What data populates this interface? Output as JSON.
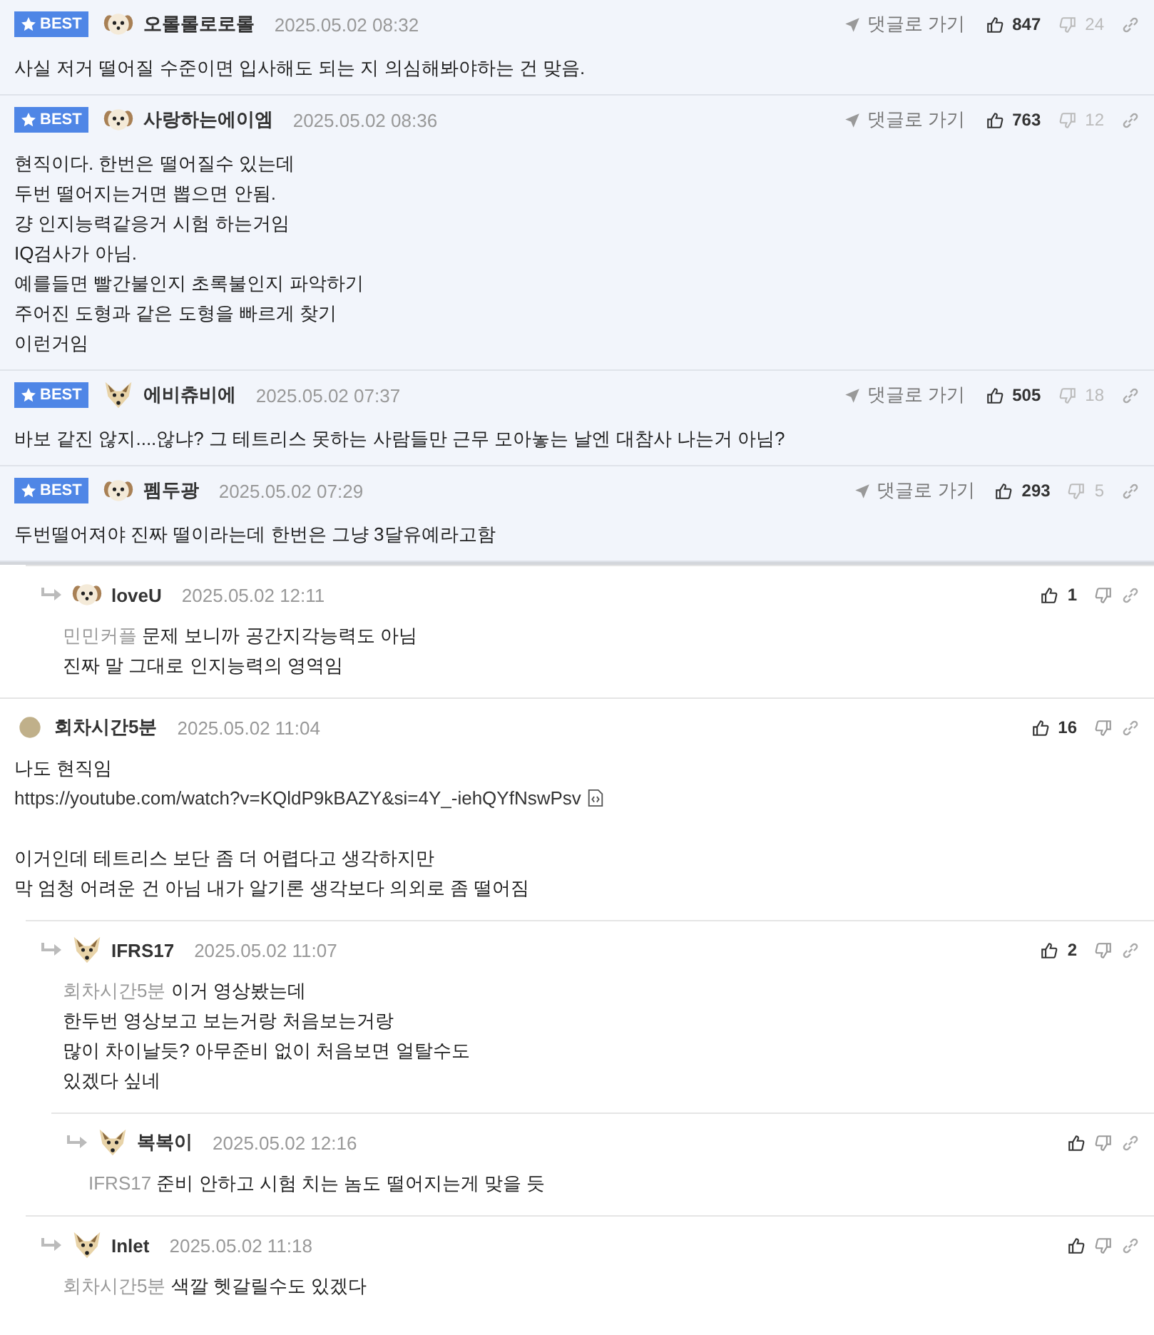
{
  "best_comments": [
    {
      "badge": "BEST",
      "author": "오롤롤로로롤",
      "kind": "puppy",
      "date": "2025.05.02 08:32",
      "goto": "댓글로 가기",
      "likes": "847",
      "dislikes": "24",
      "lines": [
        "사실 저거 떨어질 수준이면 입사해도 되는 지 의심해봐야하는 건 맞음."
      ]
    },
    {
      "badge": "BEST",
      "author": "사랑하는에이엠",
      "kind": "puppy",
      "date": "2025.05.02 08:36",
      "goto": "댓글로 가기",
      "likes": "763",
      "dislikes": "12",
      "lines": [
        "현직이다. 한번은 떨어질수 있는데",
        "두번 떨어지는거면 뽑으면 안됨.",
        "걍 인지능력같응거 시험 하는거임",
        "IQ검사가 아님.",
        "예를들면 빨간불인지 초록불인지 파악하기",
        "주어진 도형과 같은 도형을 빠르게 찾기",
        "이런거임"
      ]
    },
    {
      "badge": "BEST",
      "author": "에비츄비에",
      "kind": "fox",
      "date": "2025.05.02 07:37",
      "goto": "댓글로 가기",
      "likes": "505",
      "dislikes": "18",
      "lines": [
        "바보 같진 않지....않냐? 그 테트리스 못하는 사람들만 근무 모아놓는 날엔 대참사 나는거 아님?"
      ]
    },
    {
      "badge": "BEST",
      "author": "펨두광",
      "kind": "puppy",
      "date": "2025.05.02 07:29",
      "goto": "댓글로 가기",
      "likes": "293",
      "dislikes": "5",
      "lines": [
        "두번떨어져야 진짜 떨이라는데 한번은 그냥 3달유예라고함"
      ]
    }
  ],
  "replies_of_previous": [
    {
      "author": "loveU",
      "kind": "puppy",
      "date": "2025.05.02 12:11",
      "likes": "1",
      "mention": "민민커플",
      "paragraphs": [
        [
          {
            "kind": "text",
            "text": "문제 보니까 공간지각능력도 아님"
          },
          {
            "kind": "text",
            "text": "진짜 말 그대로 인지능력의 영역임"
          }
        ]
      ]
    }
  ],
  "comments": [
    {
      "author": "회차시간5분",
      "kind": "dot",
      "date": "2025.05.02 11:04",
      "likes": "16",
      "paragraphs": [
        [
          {
            "kind": "text",
            "text": "나도 현직임"
          },
          {
            "kind": "link",
            "text": "https://youtube.com/watch?v=KQldP9kBAZY&si=4Y_-iehQYfNswPsv"
          }
        ],
        [
          {
            "kind": "text",
            "text": "이거인데 테트리스 보단 좀 더 어렵다고 생각하지만"
          },
          {
            "kind": "text",
            "text": "막 엄청 어려운 건 아님 내가 알기론 생각보다 의외로 좀 떨어짐"
          }
        ]
      ],
      "children": [
        {
          "author": "IFRS17",
          "kind": "fox",
          "date": "2025.05.02 11:07",
          "likes": "2",
          "mention": "회차시간5분",
          "paragraphs": [
            [
              {
                "kind": "text",
                "text": "이거 영상봤는데"
              },
              {
                "kind": "text",
                "text": "한두번 영상보고 보는거랑 처음보는거랑"
              },
              {
                "kind": "text",
                "text": "많이 차이날듯? 아무준비 없이 처음보면 얼탈수도"
              },
              {
                "kind": "text",
                "text": "있겠다 싶네"
              }
            ]
          ],
          "children": [
            {
              "author": "복복이",
              "kind": "fox",
              "date": "2025.05.02 12:16",
              "mention": "IFRS17",
              "paragraphs": [
                [
                  {
                    "kind": "text",
                    "text": "준비 안하고 시험 치는 놈도 떨어지는게 맞을 듯"
                  }
                ]
              ]
            }
          ]
        },
        {
          "author": "Inlet",
          "kind": "fox",
          "date": "2025.05.02 11:18",
          "mention": "회차시간5분",
          "paragraphs": [
            [
              {
                "kind": "text",
                "text": "색깔 헷갈릴수도 있겠다"
              }
            ]
          ]
        }
      ]
    }
  ]
}
